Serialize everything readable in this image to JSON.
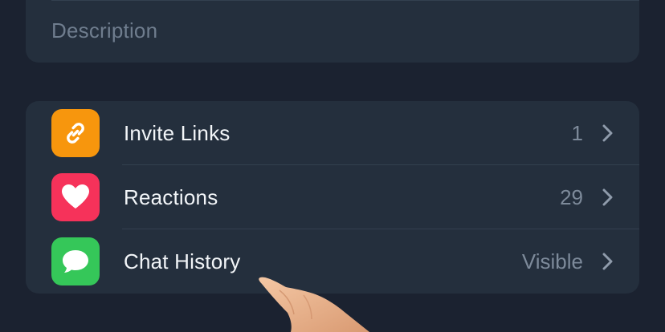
{
  "header_card": {
    "description_placeholder": "Description"
  },
  "settings": {
    "items": [
      {
        "label": "Invite Links",
        "value": "1",
        "icon": "link-icon",
        "icon_color": "#f7960d"
      },
      {
        "label": "Reactions",
        "value": "29",
        "icon": "heart-icon",
        "icon_color": "#f6325a"
      },
      {
        "label": "Chat History",
        "value": "Visible",
        "icon": "chat-bubble-icon",
        "icon_color": "#35c759"
      }
    ]
  },
  "colors": {
    "background": "#1b2230",
    "card": "#242f3d",
    "text_primary": "#f2f5f8",
    "text_secondary": "#7d8a9a"
  }
}
